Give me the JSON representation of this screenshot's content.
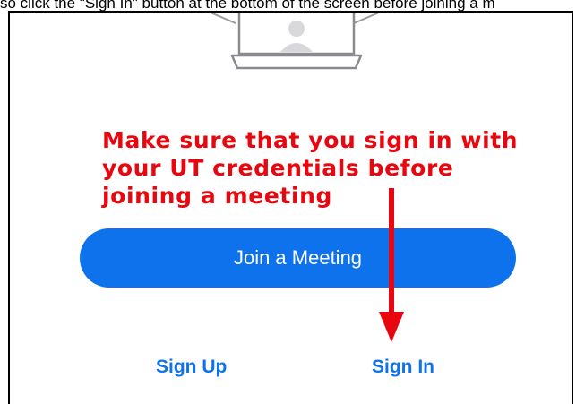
{
  "caption": "so click the \"Sign In\" button at the bottom of the screen before joining a m",
  "annotation": {
    "lines": [
      "Make sure that you sign in with",
      "your UT credentials before",
      "joining a meeting"
    ],
    "color": "#e8060f"
  },
  "buttons": {
    "join_meeting": "Join a Meeting",
    "sign_up": "Sign Up",
    "sign_in": "Sign In"
  },
  "colors": {
    "primary": "#0e72ed",
    "annotation_red": "#e8060f"
  },
  "icons": {
    "illustration": "video-call-illustration-icon",
    "arrow": "red-arrow-icon"
  }
}
